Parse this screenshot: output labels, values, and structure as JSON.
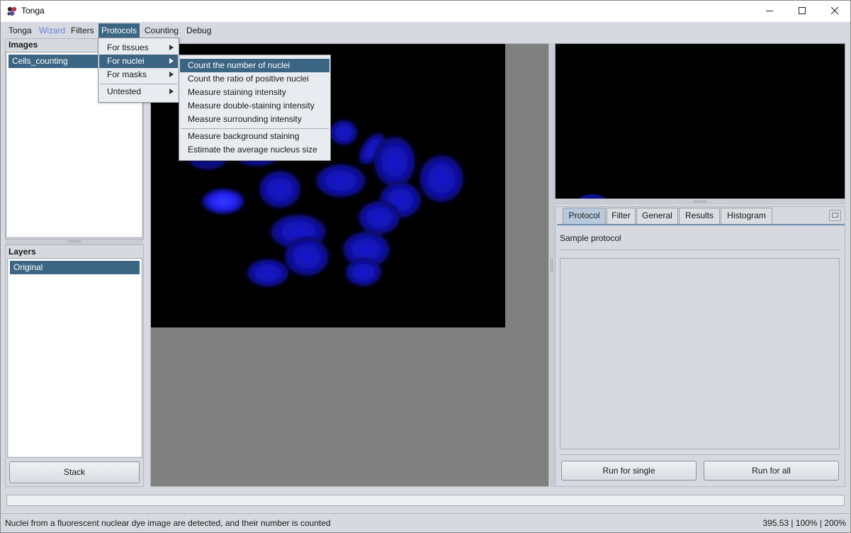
{
  "window": {
    "title": "Tonga",
    "min_icon": "minimize-icon",
    "max_icon": "maximize-icon",
    "close_icon": "close-icon"
  },
  "menubar": {
    "items": [
      {
        "label": "Tonga"
      },
      {
        "label": "Wizard"
      },
      {
        "label": "Filters"
      },
      {
        "label": "Protocols"
      },
      {
        "label": "Counting"
      },
      {
        "label": "Debug"
      }
    ],
    "active_index": 3
  },
  "protocols_menu": {
    "items": [
      {
        "label": "For tissues",
        "submenu": true
      },
      {
        "label": "For nuclei",
        "submenu": true
      },
      {
        "label": "For masks",
        "submenu": true
      },
      {
        "label": "Untested",
        "submenu": true
      }
    ],
    "active_index": 1
  },
  "nuclei_submenu": {
    "group1": [
      {
        "label": "Count the number of nuclei"
      },
      {
        "label": "Count the ratio of positive nuclei"
      },
      {
        "label": "Measure staining intensity"
      },
      {
        "label": "Measure double-staining intensity"
      },
      {
        "label": "Measure surrounding intensity"
      }
    ],
    "group2": [
      {
        "label": "Measure background staining"
      },
      {
        "label": "Estimate the average nucleus size"
      }
    ],
    "active_index": 0
  },
  "left_panel": {
    "images_label": "Images",
    "images": [
      {
        "name": "Cells_counting"
      }
    ],
    "layers_label": "Layers",
    "layers": [
      {
        "name": "Original"
      }
    ],
    "stack_button": "Stack"
  },
  "right_panel": {
    "tabs": [
      {
        "label": "Protocol"
      },
      {
        "label": "Filter"
      },
      {
        "label": "General"
      },
      {
        "label": "Results"
      },
      {
        "label": "Histogram"
      }
    ],
    "active_tab": 0,
    "protocol_name": "Sample protocol",
    "run_single": "Run for single",
    "run_all": "Run for all"
  },
  "status": {
    "message": "Nuclei from a fluorescent nuclear dye image are detected, and their number is counted",
    "info": "395.53 | 100% | 200%"
  },
  "colors": {
    "selection": "#3c6584",
    "nuclei": "#1414c8",
    "background": "#d6d9df"
  }
}
